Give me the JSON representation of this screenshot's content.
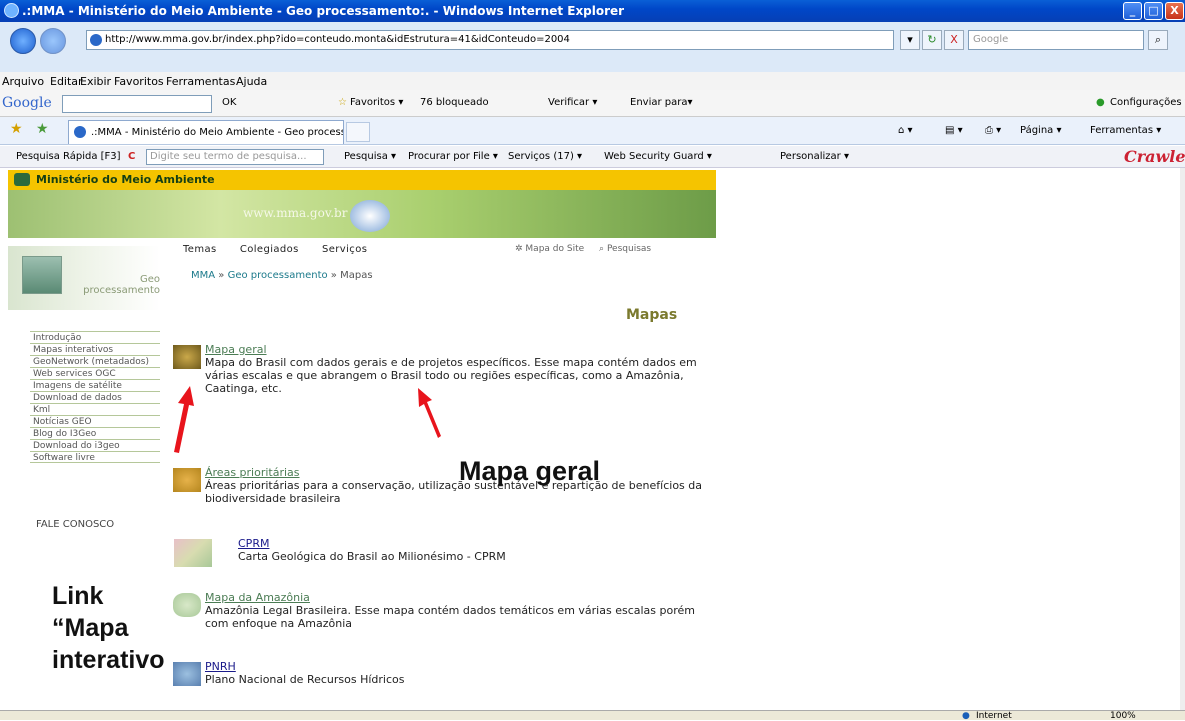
{
  "window": {
    "title": ".:MMA - Ministério do Meio Ambiente - Geo processamento:. - Windows Internet Explorer",
    "min": "_",
    "max": "□",
    "close": "X"
  },
  "address": {
    "url": "http://www.mma.gov.br/index.php?ido=conteudo.monta&idEstrutura=41&idConteudo=2004",
    "search_placeholder": "Google",
    "go": "↻",
    "stop": "X"
  },
  "menu": [
    "Arquivo",
    "Editar",
    "Exibir",
    "Favoritos",
    "Ferramentas",
    "Ajuda"
  ],
  "gbar": {
    "logo": "Google",
    "ok": "OK",
    "favoritos": "Favoritos ▾",
    "bloqueado": "76 bloqueado",
    "verificar": "Verificar ▾",
    "enviar": "Enviar para▾",
    "config": "Configurações ▾"
  },
  "tabs": {
    "active": ".:MMA - Ministério do Meio Ambiente - Geo processam...",
    "pagina": "Página ▾",
    "ferramentas": "Ferramentas ▾"
  },
  "tb2": {
    "pesquisa_rapida": "Pesquisa Rápida [F3]",
    "search_placeholder": "Digite seu termo de pesquisa...",
    "pesquisa": "Pesquisa ▾",
    "procurar": "Procurar por File ▾",
    "servicos": "Serviços (17) ▾",
    "wsg": "Web Security Guard ▾",
    "personalizar": "Personalizar ▾",
    "crawler": "Crawler"
  },
  "site": {
    "ministerio": "Ministério do Meio Ambiente",
    "url": "www.mma.gov.br",
    "nav": [
      "Temas",
      "Colegiados",
      "Serviços"
    ],
    "mapa_site": "Mapa do Site",
    "pesquisas": "Pesquisas",
    "geo": "Geo",
    "processamento": "processamento",
    "crumb_mma": "MMA",
    "crumb_geo": "Geo processamento",
    "crumb_sep": " » ",
    "crumb_current": "Mapas",
    "heading": "Mapas",
    "leftmenu": [
      "Introdução",
      "Mapas interativos",
      "GeoNetwork (metadados)",
      "Web services OGC",
      "Imagens de satélite",
      "Download de dados",
      "Kml",
      "Notícias GEO",
      "Blog do I3Geo",
      "Download do i3geo",
      "Software livre"
    ],
    "fale": "FALE CONOSCO",
    "entries": [
      {
        "title": "Mapa geral",
        "desc": "Mapa do Brasil com dados gerais e de projetos específicos. Esse mapa contém dados em várias escalas e que abrangem o Brasil todo ou regiões específicas, como a Amazônia, Caatinga, etc."
      },
      {
        "title": "Áreas prioritárias",
        "desc": "Áreas prioritárias para a conservação, utilização sustentável e repartição de benefícios da biodiversidade brasileira"
      },
      {
        "title": "CPRM",
        "desc": "Carta Geológica do Brasil ao Milionésimo - CPRM"
      },
      {
        "title": "Mapa da Amazônia",
        "desc": "Amazônia Legal Brasileira. Esse mapa contém dados temáticos em várias escalas porém com enfoque na Amazônia"
      },
      {
        "title": "PNRH",
        "desc": "Plano Nacional de Recursos Hídricos"
      }
    ]
  },
  "annotations": {
    "mapa_geral": "Mapa geral",
    "link_line1": "Link",
    "link_line2": "“Mapa",
    "link_line3": "interativo"
  },
  "status": {
    "zone": "Internet",
    "zoom": "100%"
  }
}
